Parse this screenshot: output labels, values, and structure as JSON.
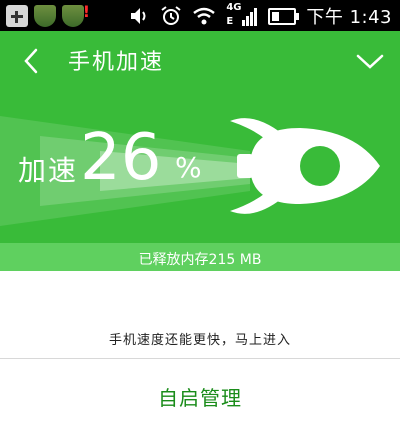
{
  "status_bar": {
    "network_top": "4G",
    "network_bottom": "E",
    "time": "下午 1:43",
    "icons": [
      "add-icon",
      "shield-icon",
      "shield-warning-icon",
      "vibrate-icon",
      "alarm-icon",
      "wifi-icon",
      "signal-icon",
      "battery-icon"
    ]
  },
  "header": {
    "title": "手机加速"
  },
  "speedup": {
    "label": "加速",
    "value": "26",
    "unit": "%",
    "memory_freed": "已释放内存215 MB"
  },
  "tip": {
    "text": "手机速度还能更快，马上进入"
  },
  "action": {
    "label": "自启管理"
  },
  "colors": {
    "primary_green": "#39bb39",
    "strip_green": "#5fd05f",
    "action_text": "#1a8c1a"
  }
}
